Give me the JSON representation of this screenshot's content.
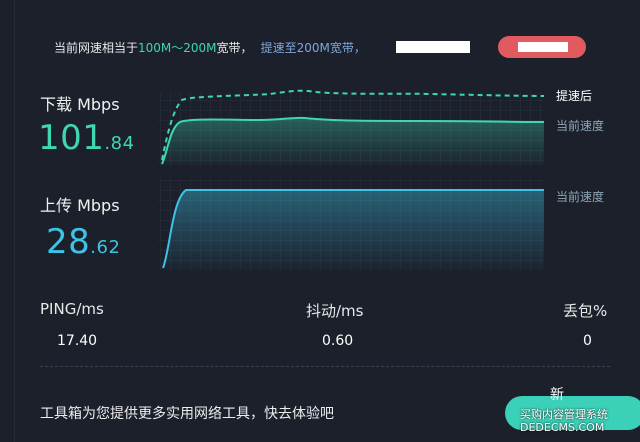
{
  "banner": {
    "text_prefix": "当前网速相当于",
    "speed_range": "100M～200M",
    "text_suffix": "宽带，",
    "upgrade_link": "提速至200M宽带，"
  },
  "download": {
    "label": "下载 Mbps",
    "value_int": "101",
    "value_dec": ".84",
    "legend_after": "提速后",
    "legend_current": "当前速度"
  },
  "upload": {
    "label": "上传 Mbps",
    "value_int": "28",
    "value_dec": ".62",
    "legend_current": "当前速度"
  },
  "stats": {
    "ping_label": "PING/ms",
    "ping_value": "17.40",
    "jitter_label": "抖动/ms",
    "jitter_value": "0.60",
    "loss_label": "丢包%",
    "loss_value": "0"
  },
  "footer": {
    "tools_text": "工具箱为您提供更多实用网络工具，快去体验吧",
    "new_label": "新",
    "watermark_line1": "买购内容管理系统",
    "watermark_line2": "DEDECMS.COM"
  },
  "colors": {
    "background": "#1b202b",
    "download": "#3fd6b3",
    "upload": "#3ec3e6",
    "banner_button": "#e05a5f"
  }
}
